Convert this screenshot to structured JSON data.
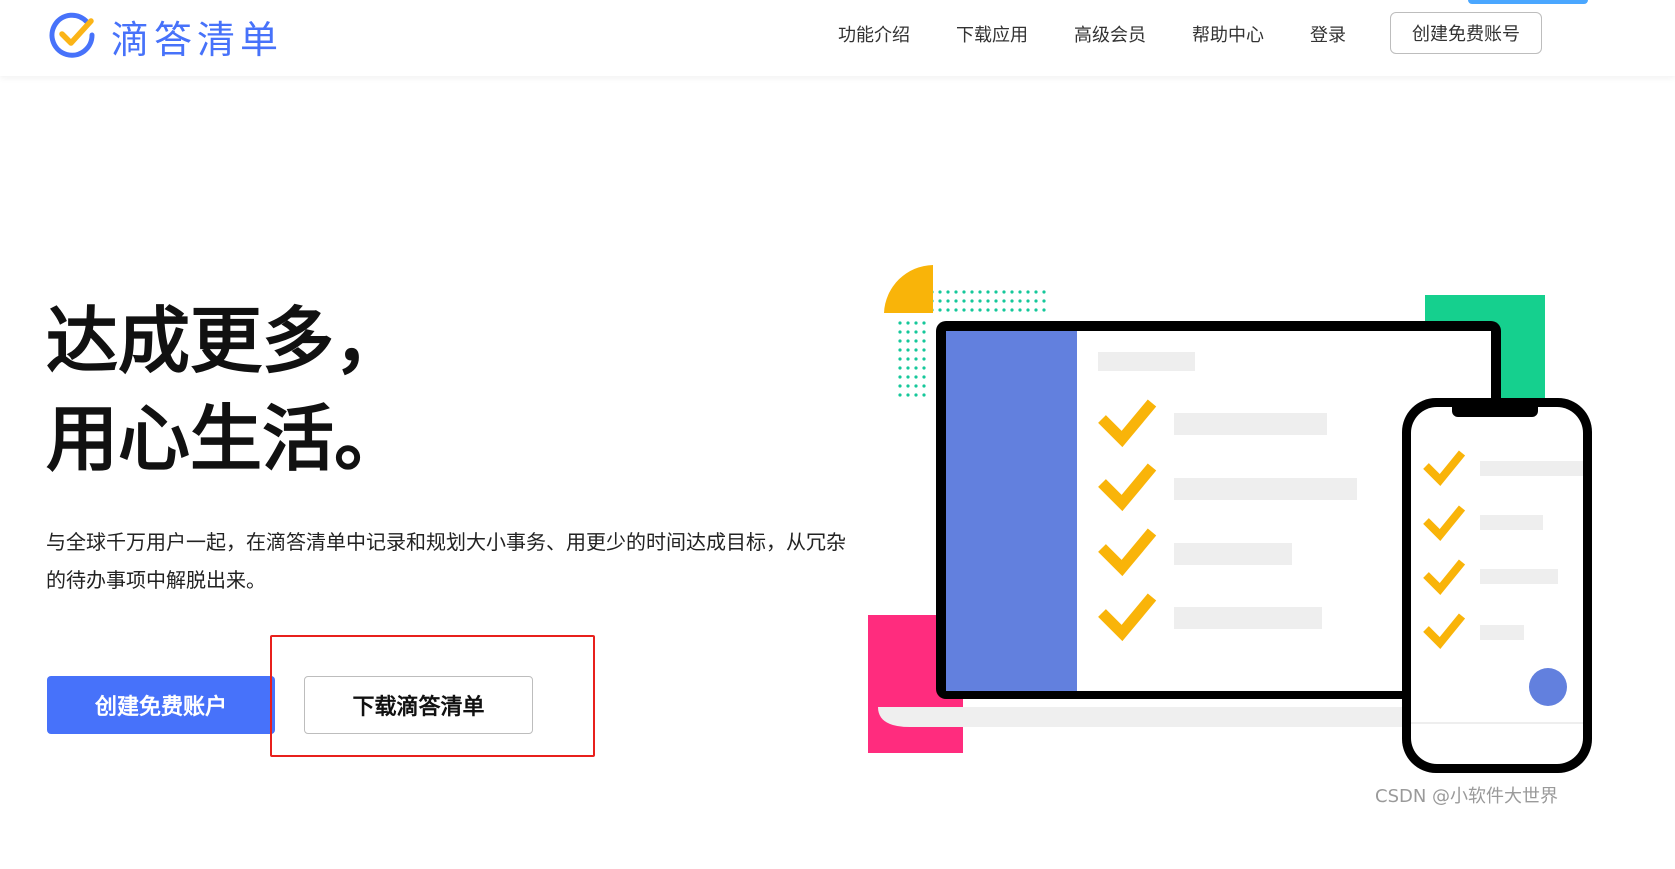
{
  "brand": {
    "name": "滴答清单",
    "logo_icon": "check-circle-icon",
    "accent_color": "#4772fa"
  },
  "nav": {
    "items": [
      {
        "label": "功能介绍"
      },
      {
        "label": "下载应用"
      },
      {
        "label": "高级会员"
      },
      {
        "label": "帮助中心"
      },
      {
        "label": "登录"
      }
    ],
    "cta_label": "创建免费账号"
  },
  "hero": {
    "headline_line1": "达成更多，",
    "headline_line2": "用心生活。",
    "description": "与全球千万用户一起，在滴答清单中记录和规划大小事务、用更少的时间达成目标，从冗杂的待办事项中解脱出来。",
    "primary_button": "创建免费账户",
    "secondary_button": "下载滴答清单"
  },
  "illustration": {
    "icons": [
      "laptop-icon",
      "phone-icon",
      "checkmark-icon"
    ],
    "colors": {
      "orange": "#f9b409",
      "green": "#15d08e",
      "pink": "#ff2c7e",
      "blue_panel": "#6280de",
      "dots": "#15c89a"
    }
  },
  "watermark": "CSDN @小软件大世界"
}
